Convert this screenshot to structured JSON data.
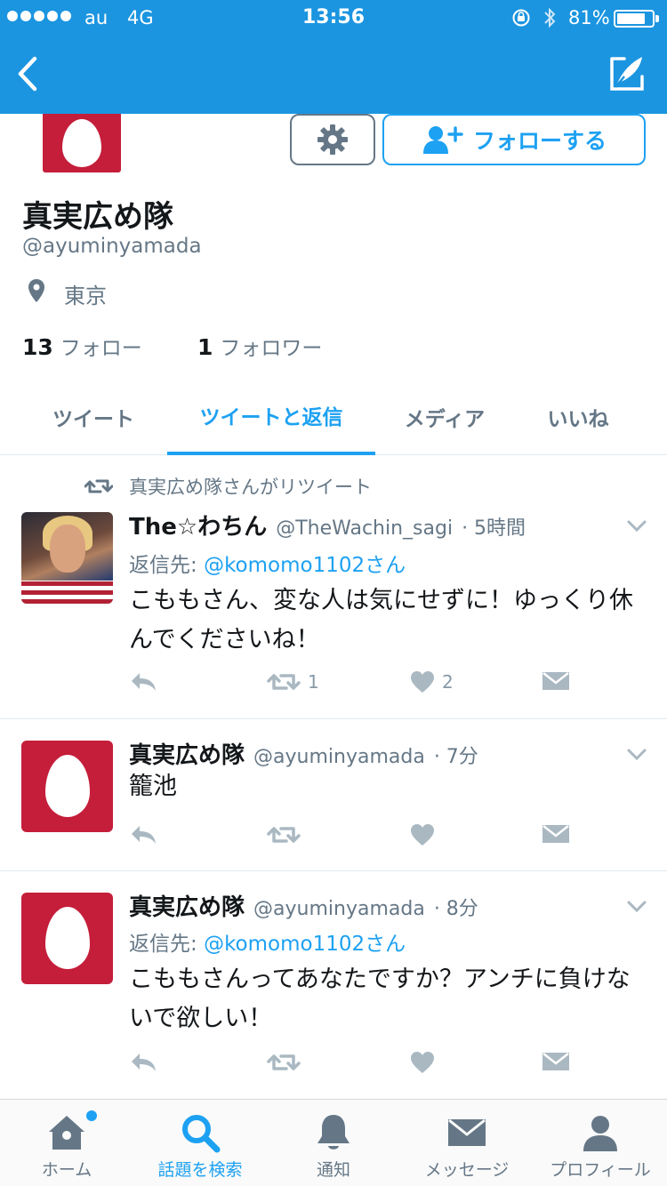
{
  "status_bar": {
    "carrier": "au",
    "network": "4G",
    "time": "13:56",
    "battery_percent_text": "81%",
    "battery_level": 0.81,
    "signal_dots": 5
  },
  "nav": {
    "back_icon": "chevron-left-icon",
    "compose_icon": "compose-tweet-icon"
  },
  "profile": {
    "name": "真実広め隊",
    "handle": "@ayuminyamada",
    "location": "東京",
    "following_count": "13",
    "following_label": "フォロー",
    "followers_count": "1",
    "followers_label": "フォロワー",
    "follow_button": "フォローする",
    "settings_icon": "gear-icon",
    "brand_color": "#1da1f2",
    "header_color": "#1b95e0",
    "avatar_color": "#c41e3a"
  },
  "tabs": [
    {
      "label": "ツイート",
      "active": false
    },
    {
      "label": "ツイートと返信",
      "active": true
    },
    {
      "label": "メディア",
      "active": false
    },
    {
      "label": "いいね",
      "active": false
    }
  ],
  "tweets": [
    {
      "retweet_by": "真実広め隊さんがリツイート",
      "name": "The☆わちん",
      "handle": "@TheWachin_sagi",
      "time": "· 5時間",
      "reply_prefix": "返信先: ",
      "reply_to": "@komomo1102さん",
      "text": "こももさん、変な人は気にせずに！ゆっくり休んでくださいね！",
      "retweets": "1",
      "likes": "2"
    },
    {
      "name": "真実広め隊",
      "handle": "@ayuminyamada",
      "time": "· 7分",
      "text": "籠池"
    },
    {
      "name": "真実広め隊",
      "handle": "@ayuminyamada",
      "time": "· 8分",
      "reply_prefix": "返信先: ",
      "reply_to": "@komomo1102さん",
      "text": "こももさんってあなたですか？アンチに負けないで欲しい！"
    }
  ],
  "tabbar": [
    {
      "label": "ホーム",
      "icon": "home-icon",
      "active": false
    },
    {
      "label": "話題を検索",
      "icon": "search-icon",
      "active": true
    },
    {
      "label": "通知",
      "icon": "bell-icon",
      "active": false
    },
    {
      "label": "メッセージ",
      "icon": "envelope-icon",
      "active": false
    },
    {
      "label": "プロフィール",
      "icon": "person-icon",
      "active": false
    }
  ]
}
